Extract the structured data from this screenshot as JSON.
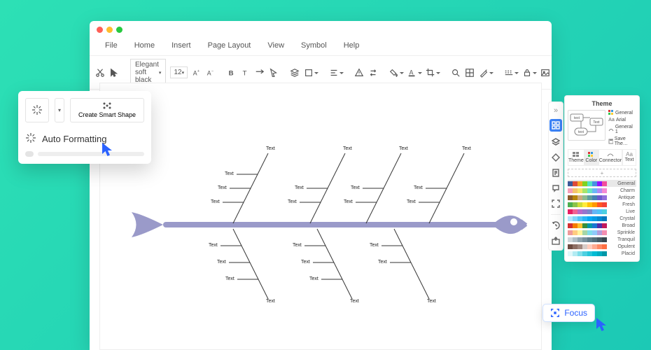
{
  "menus": [
    "File",
    "Home",
    "Insert",
    "Page Layout",
    "View",
    "Symbol",
    "Help"
  ],
  "toolbar": {
    "font_name": "Elegant soft black",
    "font_size": "12"
  },
  "smart_popup": {
    "create_label": "Create Smart Shape",
    "auto_format_label": "Auto Formatting"
  },
  "rail_expand": "»",
  "theme": {
    "title": "Theme",
    "side": {
      "general": "General",
      "font": "Arial",
      "connector": "General 1",
      "save": "Save The…"
    },
    "tabs": {
      "theme": "Theme",
      "color": "Color",
      "connector": "Connector",
      "text": "Text"
    },
    "add": "+",
    "preview_label_1": "text",
    "preview_label_2": "text",
    "preview_label_3": "Text",
    "schemes": [
      {
        "name": "General",
        "c": [
          "#3b5998",
          "#dd4b39",
          "#f5a623",
          "#7ed321",
          "#50e3c2",
          "#4a90e2",
          "#9013fe",
          "#f24e9c"
        ]
      },
      {
        "name": "Charm",
        "c": [
          "#f59fb9",
          "#f5c56b",
          "#f5e56b",
          "#a8e56b",
          "#6be5c1",
          "#6bb7f5",
          "#b08bf5",
          "#f58bd3"
        ]
      },
      {
        "name": "Antique",
        "c": [
          "#8b5a2b",
          "#b8860b",
          "#cdaa7d",
          "#8fbc8f",
          "#5f9ea0",
          "#4682b4",
          "#6a5acd",
          "#9370db"
        ]
      },
      {
        "name": "Fresh",
        "c": [
          "#4caf50",
          "#8bc34a",
          "#cddc39",
          "#ffeb3b",
          "#ffc107",
          "#ff9800",
          "#ff5722",
          "#f44336"
        ]
      },
      {
        "name": "Live",
        "c": [
          "#e91e63",
          "#f06292",
          "#ba68c8",
          "#9575cd",
          "#7986cb",
          "#64b5f6",
          "#4fc3f7",
          "#4dd0e1"
        ]
      },
      {
        "name": "Crystal",
        "c": [
          "#b3e5fc",
          "#81d4fa",
          "#4fc3f7",
          "#29b6f6",
          "#03a9f4",
          "#039be5",
          "#0288d1",
          "#0277bd"
        ]
      },
      {
        "name": "Broad",
        "c": [
          "#d32f2f",
          "#f57c00",
          "#fbc02d",
          "#388e3c",
          "#0097a7",
          "#1976d2",
          "#512da8",
          "#c2185b"
        ]
      },
      {
        "name": "Sprinkle",
        "c": [
          "#ef9a9a",
          "#ffcc80",
          "#fff59d",
          "#a5d6a7",
          "#80deea",
          "#90caf9",
          "#b39ddb",
          "#f48fb1"
        ]
      },
      {
        "name": "Tranquil",
        "c": [
          "#cfd8dc",
          "#b0bec5",
          "#90a4ae",
          "#78909c",
          "#607d8b",
          "#546e7a",
          "#455a64",
          "#37474f"
        ]
      },
      {
        "name": "Opulent",
        "c": [
          "#6d4c41",
          "#8d6e63",
          "#a1887f",
          "#d7ccc8",
          "#ffccbc",
          "#ffab91",
          "#ff8a65",
          "#ff7043"
        ]
      },
      {
        "name": "Placid",
        "c": [
          "#e0f7fa",
          "#b2ebf2",
          "#80deea",
          "#4dd0e1",
          "#26c6da",
          "#00bcd4",
          "#00acc1",
          "#0097a7"
        ]
      }
    ]
  },
  "focus": {
    "label": "Focus"
  },
  "diagram_label": "Text"
}
